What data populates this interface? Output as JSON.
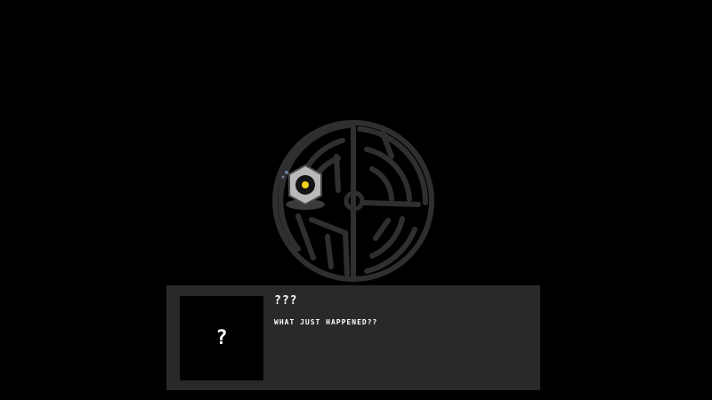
{
  "colors": {
    "background": "#000000",
    "dialog_bg": "#29282b",
    "portrait_bg": "#000000",
    "maze_stroke": "#2f2f31",
    "text": "#ffffff",
    "robot_eye": "#f2d21b"
  },
  "icons": {
    "maze_disc": "circular-maze-icon",
    "character": "hex-robot-icon"
  },
  "dialog": {
    "portrait_glyph": "?",
    "speaker": "???",
    "line": "WHAT JUST HAPPENED??"
  }
}
